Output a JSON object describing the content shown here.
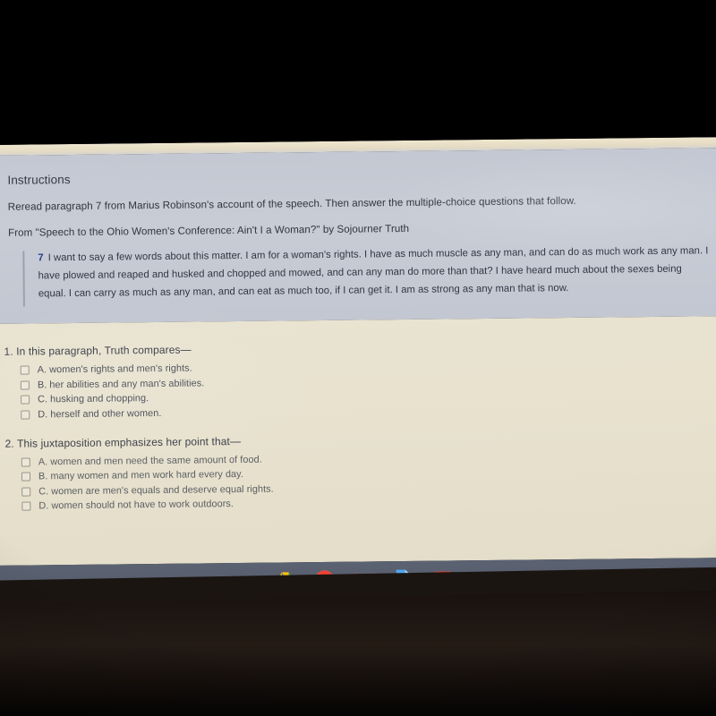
{
  "instructions": {
    "title": "Instructions",
    "directive": "Reread paragraph 7 from Marius Robinson's account of the speech. Then answer the multiple-choice questions that follow.",
    "source": "From \"Speech to the Ohio Women's Conference: Ain't I a Woman?\" by Sojourner Truth",
    "passage": {
      "number": "7",
      "text": "I want to say a few words about this matter. I am for a woman's rights. I have as much muscle as any man, and can do as much work as any man. I have plowed and reaped and husked and chopped and mowed, and can any man do more than that? I have heard much about the sexes being equal. I can carry as much as any man, and can eat as much too, if I can get it. I am as strong as any man that is now."
    }
  },
  "questions": [
    {
      "number": "1.",
      "stem": "In this paragraph, Truth compares—",
      "options": [
        "A. women's rights and men's rights.",
        "B. her abilities and any man's abilities.",
        "C. husking and chopping.",
        "D. herself and other women."
      ]
    },
    {
      "number": "2.",
      "stem": "This juxtaposition emphasizes her point that—",
      "options": [
        "A. women and men need the same amount of food.",
        "B. many women and men work hard every day.",
        "C. women are men's equals and deserve equal rights.",
        "D. women should not have to work outdoors."
      ]
    }
  ],
  "shelf": {
    "items": [
      {
        "icon": "google-drive-icon",
        "label": "Google Drive"
      },
      {
        "icon": "google-chrome-icon",
        "label": "Google Chrome"
      },
      {
        "icon": "gmail-icon",
        "label": "Gmail"
      },
      {
        "icon": "google-slides-icon",
        "label": "Google Slides"
      },
      {
        "icon": "youtube-icon",
        "label": "YouTube"
      }
    ]
  },
  "colors": {
    "instructions_panel": "#C5CAD4",
    "questions_background": "#E8E2D0",
    "shelf": "#575E6D",
    "body_text": "#2F3640",
    "passage_number": "#2C3D86",
    "checkbox_border": "#9A958A",
    "bezel": "#000000"
  }
}
